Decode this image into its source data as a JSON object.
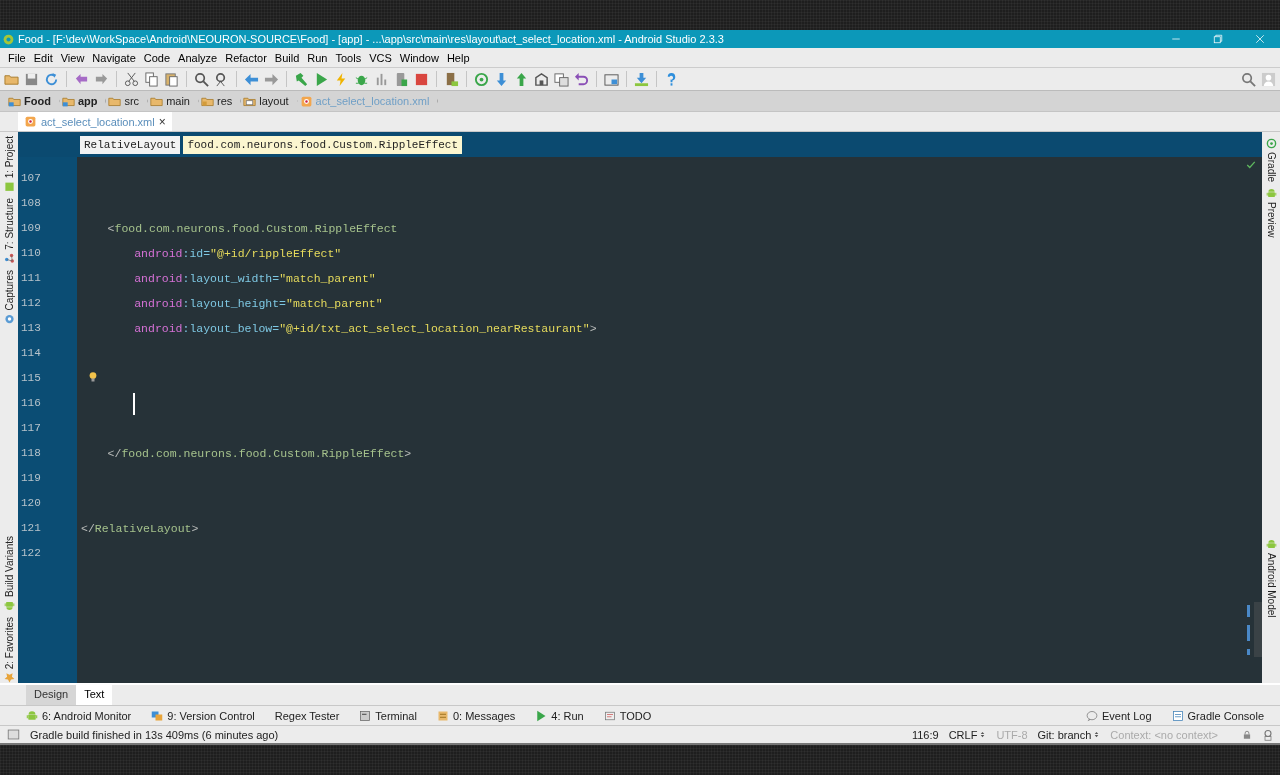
{
  "window": {
    "title": "Food - [F:\\dev\\WorkSpace\\Android\\NEOURON-SOURCE\\Food] - [app] - ...\\app\\src\\main\\res\\layout\\act_select_location.xml - Android Studio 2.3.3"
  },
  "menu": [
    "File",
    "Edit",
    "View",
    "Navigate",
    "Code",
    "Analyze",
    "Refactor",
    "Build",
    "Run",
    "Tools",
    "VCS",
    "Window",
    "Help"
  ],
  "breadcrumbs": [
    {
      "label": "Food",
      "kind": "module"
    },
    {
      "label": "app",
      "kind": "module"
    },
    {
      "label": "src",
      "kind": "folder"
    },
    {
      "label": "main",
      "kind": "folder"
    },
    {
      "label": "res",
      "kind": "resfolder"
    },
    {
      "label": "layout",
      "kind": "layoutfolder"
    },
    {
      "label": "act_select_location.xml",
      "kind": "file"
    }
  ],
  "editor_tabs": [
    {
      "label": "act_select_location.xml",
      "selected": true,
      "close": "×"
    }
  ],
  "tag_path": [
    {
      "label": "RelativeLayout",
      "selected": false
    },
    {
      "label": "food.com.neurons.food.Custom.RippleEffect",
      "selected": true
    }
  ],
  "code_lines": [
    {
      "number": "107"
    },
    {
      "number": "108"
    },
    {
      "number": "109",
      "kind": "element",
      "tokens": [
        {
          "kind": "punct",
          "text": "<"
        },
        {
          "kind": "tag",
          "text": "food.com.neurons.food.Custom.RippleEffect"
        }
      ]
    },
    {
      "number": "110",
      "kind": "attribute",
      "tokens": [
        {
          "kind": "ns",
          "text": "android"
        },
        {
          "kind": "attr",
          "text": ":id="
        },
        {
          "kind": "value",
          "text": "\"@+id/rippleEffect\""
        }
      ]
    },
    {
      "number": "111",
      "kind": "attribute",
      "tokens": [
        {
          "kind": "ns",
          "text": "android"
        },
        {
          "kind": "attr",
          "text": ":layout_width="
        },
        {
          "kind": "value",
          "text": "\"match_parent\""
        }
      ]
    },
    {
      "number": "112",
      "kind": "attribute",
      "tokens": [
        {
          "kind": "ns",
          "text": "android"
        },
        {
          "kind": "attr",
          "text": ":layout_height="
        },
        {
          "kind": "value",
          "text": "\"match_parent\""
        }
      ]
    },
    {
      "number": "113",
      "kind": "attribute",
      "tokens": [
        {
          "kind": "ns",
          "text": "android"
        },
        {
          "kind": "attr",
          "text": ":layout_below="
        },
        {
          "kind": "value",
          "text": "\"@+id/txt_act_select_location_nearRestaurant\""
        },
        {
          "kind": "punct",
          "text": ">"
        }
      ]
    },
    {
      "number": "114"
    },
    {
      "number": "115",
      "bulb": true
    },
    {
      "number": "116",
      "caret": true
    },
    {
      "number": "117"
    },
    {
      "number": "118",
      "kind": "element",
      "tokens": [
        {
          "kind": "punct",
          "text": "</"
        },
        {
          "kind": "tag",
          "text": "food.com.neurons.food.Custom.RippleEffect"
        },
        {
          "kind": "punct",
          "text": ">"
        }
      ]
    },
    {
      "number": "119"
    },
    {
      "number": "120"
    },
    {
      "number": "121",
      "kind": "root",
      "tokens": [
        {
          "kind": "punct",
          "text": "</"
        },
        {
          "kind": "tag",
          "text": "RelativeLayout"
        },
        {
          "kind": "punct",
          "text": ">"
        }
      ]
    },
    {
      "number": "122"
    }
  ],
  "left_tools": [
    {
      "label": "1: Project",
      "kind": "project"
    },
    {
      "label": "7: Structure",
      "kind": "structure"
    },
    {
      "label": "Captures",
      "kind": "captures"
    },
    {
      "label": "Build Variants",
      "kind": "android"
    },
    {
      "label": "2: Favorites",
      "kind": "star"
    }
  ],
  "right_tools": [
    {
      "label": "Gradle",
      "kind": "gradle"
    },
    {
      "label": "Preview",
      "kind": "android"
    },
    {
      "label": "Android Model",
      "kind": "android"
    }
  ],
  "view_tabs": [
    {
      "label": "Design",
      "selected": false
    },
    {
      "label": "Text",
      "selected": true
    }
  ],
  "tool_windows": [
    {
      "label": "6: Android Monitor",
      "kind": "android"
    },
    {
      "label": "9: Version Control",
      "kind": "vcs"
    },
    {
      "label": "Regex Tester",
      "kind": "plain"
    },
    {
      "label": "Terminal",
      "kind": "terminal"
    },
    {
      "label": "0: Messages",
      "kind": "messages"
    },
    {
      "label": "4: Run",
      "kind": "run"
    },
    {
      "label": "TODO",
      "kind": "todo"
    }
  ],
  "tool_windows_right": [
    {
      "label": "Event Log",
      "kind": "eventlog"
    },
    {
      "label": "Gradle Console",
      "kind": "console"
    }
  ],
  "status_bar": {
    "message": "Gradle build finished in 13s 409ms (6 minutes ago)",
    "position": "116:9",
    "line_separator": "CRLF",
    "encoding": {
      "text": "UTF-8",
      "disabled": true
    },
    "vcs": "Git: branch",
    "context": {
      "text": "Context: <no context>",
      "disabled": true
    }
  }
}
